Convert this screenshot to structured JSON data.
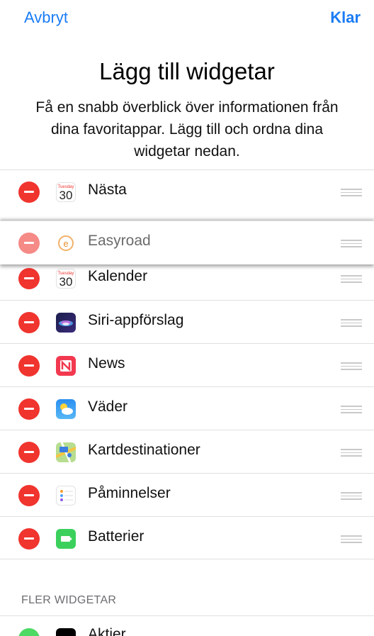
{
  "nav": {
    "cancel_label": "Avbryt",
    "done_label": "Klar"
  },
  "header": {
    "title": "Lägg till widgetar",
    "subtitle": "Få en snabb överblick över informationen från dina favoritappar. Lägg till och ordna dina widgetar nedan."
  },
  "widgets": [
    {
      "label": "Nästa",
      "icon": "calendar-icon",
      "icon_day": "Tuesday",
      "icon_date": "30"
    },
    {
      "label": "Easyroad",
      "icon": "easyroad-icon",
      "dragging": true
    },
    {
      "label": "Kalender",
      "icon": "calendar-icon",
      "icon_day": "Tuesday",
      "icon_date": "30"
    },
    {
      "label": "Siri-appförslag",
      "icon": "siri-icon"
    },
    {
      "label": "News",
      "icon": "news-icon"
    },
    {
      "label": "Väder",
      "icon": "weather-icon"
    },
    {
      "label": "Kartdestinationer",
      "icon": "maps-icon"
    },
    {
      "label": "Påminnelser",
      "icon": "reminders-icon"
    },
    {
      "label": "Batterier",
      "icon": "battery-icon"
    }
  ],
  "more": {
    "section_title": "FLER WIDGETAR",
    "items": [
      {
        "label": "Aktier",
        "icon": "stocks-icon"
      }
    ]
  },
  "colors": {
    "accent": "#1a7cf5",
    "delete": "#f0342e",
    "add": "#4cd964"
  }
}
